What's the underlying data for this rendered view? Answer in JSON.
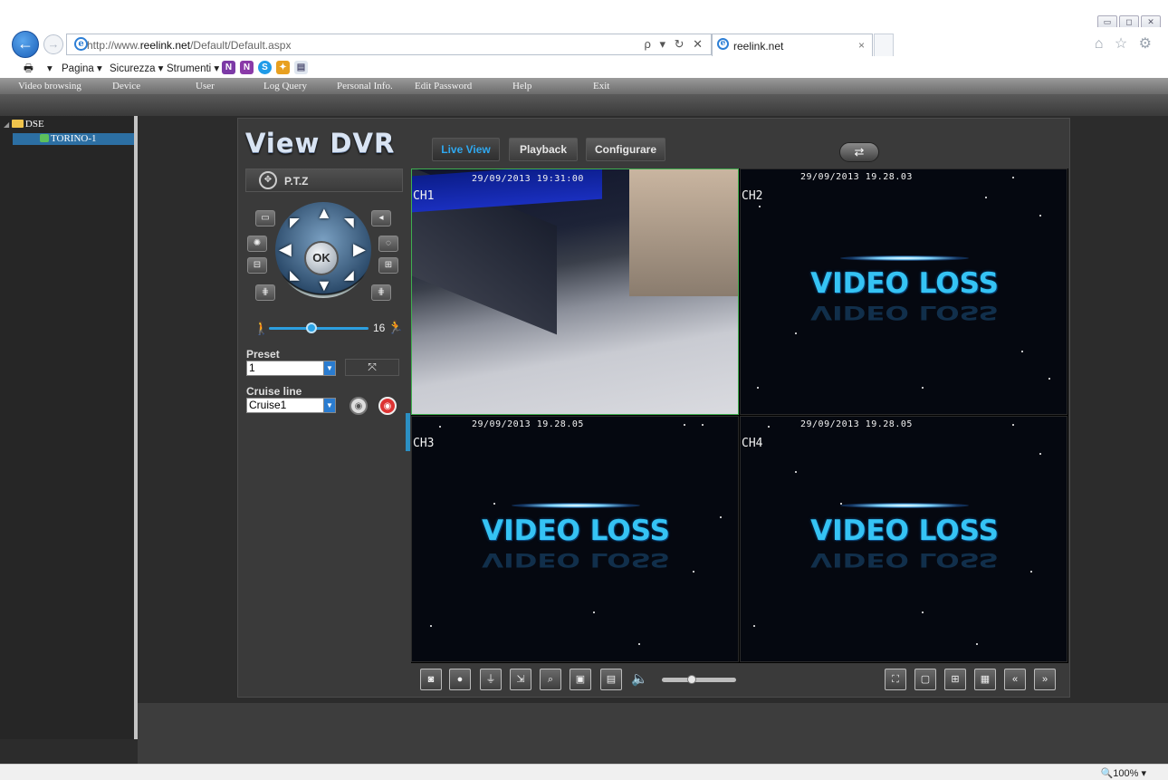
{
  "browser": {
    "url_prefix": "http://www.",
    "url_domain": "reelink.net",
    "url_path": "/Default/Default.aspx",
    "addr_tools": "ρ ▾ ↻ ✕",
    "tab_label": "reelink.net",
    "tab_close": "×",
    "right_icons": "⌂ ☆ ⚙",
    "window_buttons": [
      "▭",
      "◻",
      "✕"
    ],
    "back_glyph": "←",
    "forward_glyph": "→",
    "zoom": "100%",
    "command_bar": {
      "print": "▾",
      "pagina": "Pagina ▾",
      "sicurezza": "Sicurezza ▾",
      "strumenti": "Strumenti ▾"
    }
  },
  "site_menu": [
    "Video browsing",
    "Device",
    "User",
    "Log Query",
    "Personal Info.",
    "Edit Password",
    "Help",
    "Exit"
  ],
  "tree": {
    "root": "DSE",
    "child": "TORINO-1"
  },
  "dvr": {
    "logo": "View DVR",
    "tabs": [
      "Live View",
      "Playback",
      "Configurare"
    ],
    "switch_glyph": "⇄",
    "ptz": {
      "title": "P.T.Z",
      "ok": "OK",
      "speed_min_icon": "🚶",
      "speed_value": "16",
      "speed_max_icon": "🏃",
      "speed_fraction": 0.43,
      "preset_label": "Preset",
      "preset_value": "1",
      "cruise_label": "Cruise line",
      "cruise_value": "Cruise1"
    },
    "channels": [
      {
        "label": "CH1",
        "timestamp": "29/09/2013 19:31:00",
        "status": ""
      },
      {
        "label": "CH2",
        "timestamp": "29/09/2013 19.28.03",
        "status": "VIDEO LOSS"
      },
      {
        "label": "CH3",
        "timestamp": "29/09/2013 19.28.05",
        "status": "VIDEO LOSS"
      },
      {
        "label": "CH4",
        "timestamp": "29/09/2013 19.28.05",
        "status": "VIDEO LOSS"
      }
    ],
    "volume_fraction": 0.4,
    "colors": {
      "accent": "#2fa8ef",
      "video_loss": "#35c3f4",
      "selected_pane": "#3fae4f"
    }
  }
}
